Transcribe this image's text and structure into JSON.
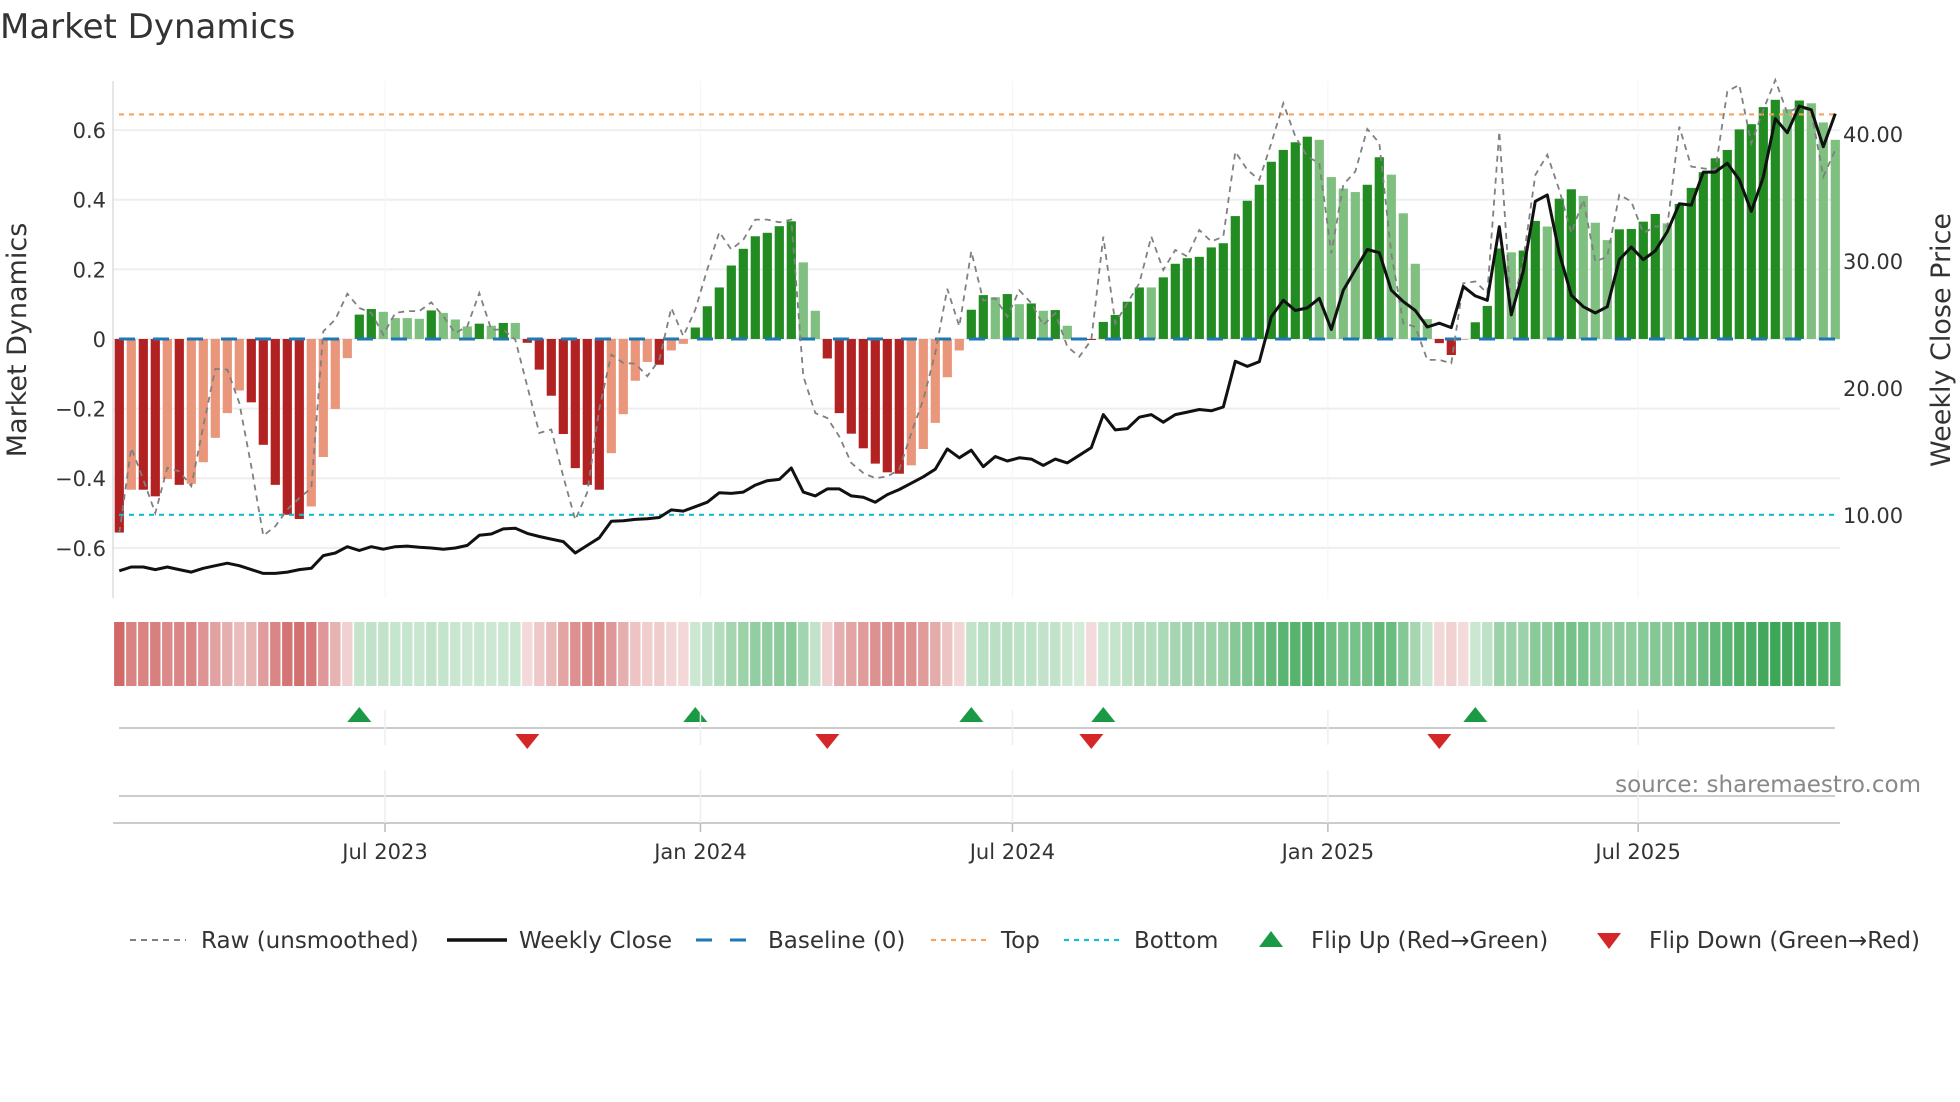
{
  "chart_data": {
    "type": "bar",
    "title": "Market Dynamics",
    "ylabel": "Market Dynamics",
    "ylabel_right": "Weekly Close Price",
    "ylim": [
      -0.744,
      0.741
    ],
    "ylim_right": [
      3.46,
      44.17
    ],
    "yticks": [
      {
        "v": 0.6,
        "label": "0.6"
      },
      {
        "v": 0.4,
        "label": "0.4"
      },
      {
        "v": 0.2,
        "label": "0.2"
      },
      {
        "v": 0,
        "label": "0"
      },
      {
        "v": -0.2,
        "label": "−0.2"
      },
      {
        "v": -0.4,
        "label": "−0.4"
      },
      {
        "v": -0.6,
        "label": "−0.6"
      }
    ],
    "yticks_right": [
      {
        "v": 40,
        "label": "40.00"
      },
      {
        "v": 30,
        "label": "30.00"
      },
      {
        "v": 20,
        "label": "20.00"
      },
      {
        "v": 10,
        "label": "10.00"
      }
    ],
    "x_start": "2023-01-27",
    "x_step_days": 7,
    "xticks": [
      {
        "date": "2023-07-01",
        "label": "Jul 2023"
      },
      {
        "date": "2024-01-01",
        "label": "Jan 2024"
      },
      {
        "date": "2024-07-01",
        "label": "Jul 2024"
      },
      {
        "date": "2025-01-01",
        "label": "Jan 2025"
      },
      {
        "date": "2025-07-01",
        "label": "Jul 2025"
      }
    ],
    "top_level": 0.645,
    "bottom_level": -0.505,
    "baseline": 0,
    "smoothed": [
      -0.556,
      -0.433,
      -0.433,
      -0.452,
      -0.402,
      -0.419,
      -0.416,
      -0.354,
      -0.284,
      -0.213,
      -0.148,
      -0.182,
      -0.304,
      -0.419,
      -0.505,
      -0.517,
      -0.481,
      -0.339,
      -0.201,
      -0.055,
      0.07,
      0.086,
      0.078,
      0.06,
      0.06,
      0.058,
      0.082,
      0.075,
      0.056,
      0.036,
      0.044,
      0.038,
      0.046,
      0.046,
      -0.011,
      -0.088,
      -0.163,
      -0.273,
      -0.371,
      -0.419,
      -0.433,
      -0.328,
      -0.216,
      -0.12,
      -0.066,
      -0.074,
      -0.033,
      -0.014,
      0.033,
      0.094,
      0.148,
      0.211,
      0.259,
      0.295,
      0.305,
      0.324,
      0.338,
      0.22,
      0.081,
      -0.056,
      -0.213,
      -0.272,
      -0.314,
      -0.358,
      -0.383,
      -0.387,
      -0.363,
      -0.316,
      -0.241,
      -0.11,
      -0.033,
      0.084,
      0.126,
      0.12,
      0.129,
      0.1,
      0.102,
      0.081,
      0.083,
      0.038,
      0.002,
      -0.003,
      0.049,
      0.069,
      0.107,
      0.148,
      0.148,
      0.177,
      0.216,
      0.232,
      0.236,
      0.263,
      0.275,
      0.353,
      0.397,
      0.443,
      0.509,
      0.543,
      0.565,
      0.581,
      0.572,
      0.465,
      0.432,
      0.422,
      0.443,
      0.522,
      0.472,
      0.361,
      0.216,
      0.057,
      -0.012,
      -0.046,
      -0.002,
      0.048,
      0.095,
      0.26,
      0.249,
      0.254,
      0.339,
      0.323,
      0.403,
      0.43,
      0.411,
      0.334,
      0.284,
      0.315,
      0.316,
      0.337,
      0.359,
      0.332,
      0.388,
      0.434,
      0.479,
      0.519,
      0.543,
      0.602,
      0.617,
      0.666,
      0.687,
      0.66,
      0.685,
      0.677,
      0.622,
      0.572
    ],
    "strength": "DLDDLDLLLLLDDDDDLLLLDDLLLLDLLLDLDLDDDDDDDLLLLDLLDDDDDDDDDLLDDDDDDDLLLLLDDLDLDLDLLDDDDDLDDDDDDDDDDDDDLLLLDDLLLLDDLDDDLDDLDDLLLDDDDLDDDDDDDDDLDLLL",
    "raw": [
      -0.557,
      -0.313,
      -0.404,
      -0.5,
      -0.37,
      -0.38,
      -0.423,
      -0.25,
      -0.086,
      -0.088,
      -0.184,
      -0.366,
      -0.565,
      -0.538,
      -0.49,
      -0.457,
      -0.428,
      0.022,
      0.056,
      0.13,
      0.089,
      0.075,
      0.012,
      0.075,
      0.08,
      0.08,
      0.105,
      0.065,
      0.017,
      0.036,
      0.132,
      0.027,
      0.027,
      -0.002,
      -0.136,
      -0.27,
      -0.26,
      -0.395,
      -0.52,
      -0.44,
      -0.2,
      -0.045,
      -0.069,
      -0.071,
      -0.107,
      -0.06,
      0.089,
      0.008,
      0.084,
      0.2,
      0.307,
      0.257,
      0.285,
      0.343,
      0.343,
      0.335,
      0.343,
      -0.107,
      -0.213,
      -0.227,
      -0.28,
      -0.356,
      -0.385,
      -0.4,
      -0.395,
      -0.375,
      -0.27,
      -0.174,
      -0.04,
      0.144,
      0.036,
      0.252,
      0.11,
      0.117,
      0.064,
      0.14,
      0.103,
      0.04,
      0.074,
      -0.022,
      -0.051,
      -0.003,
      0.294,
      0.045,
      0.103,
      0.16,
      0.294,
      0.198,
      0.256,
      0.237,
      0.313,
      0.28,
      0.294,
      0.538,
      0.486,
      0.457,
      0.562,
      0.677,
      0.582,
      0.524,
      0.505,
      0.246,
      0.443,
      0.481,
      0.603,
      0.563,
      0.246,
      0.045,
      0.035,
      -0.06,
      -0.06,
      -0.07,
      0.16,
      0.165,
      0.131,
      0.596,
      0.074,
      0.227,
      0.471,
      0.529,
      0.428,
      0.304,
      0.4,
      0.222,
      0.237,
      0.414,
      0.395,
      0.304,
      0.323,
      0.323,
      0.61,
      0.495,
      0.49,
      0.486,
      0.711,
      0.73,
      0.562,
      0.658,
      0.744,
      0.649,
      0.668,
      0.653,
      0.466,
      0.543
    ],
    "close": [
      5.6,
      5.9,
      5.9,
      5.7,
      5.9,
      5.7,
      5.5,
      5.8,
      6.0,
      6.2,
      6.0,
      5.7,
      5.4,
      5.4,
      5.5,
      5.7,
      5.8,
      6.8,
      7.0,
      7.5,
      7.2,
      7.5,
      7.3,
      7.5,
      7.55,
      7.45,
      7.4,
      7.3,
      7.4,
      7.6,
      8.4,
      8.5,
      8.9,
      8.95,
      8.55,
      8.3,
      8.1,
      7.9,
      7.0,
      7.6,
      8.2,
      9.5,
      9.55,
      9.65,
      9.7,
      9.8,
      10.4,
      10.3,
      10.65,
      11.0,
      11.75,
      11.7,
      11.8,
      12.35,
      12.7,
      12.8,
      13.7,
      11.8,
      11.5,
      12.05,
      12.05,
      11.5,
      11.4,
      11.0,
      11.6,
      12.0,
      12.5,
      13.0,
      13.6,
      15.2,
      14.5,
      15.1,
      13.8,
      14.6,
      14.25,
      14.5,
      14.4,
      13.9,
      14.4,
      14.1,
      14.7,
      15.3,
      17.9,
      16.7,
      16.8,
      17.7,
      17.9,
      17.3,
      17.9,
      18.1,
      18.3,
      18.2,
      18.5,
      22.1,
      21.7,
      22.07,
      25.6,
      26.9,
      26.1,
      26.3,
      27.06,
      24.6,
      27.7,
      29.3,
      30.9,
      30.65,
      27.7,
      26.8,
      26.1,
      24.8,
      25.1,
      24.75,
      28.0,
      27.25,
      26.9,
      32.7,
      25.75,
      29.2,
      34.7,
      35.2,
      30.6,
      27.3,
      26.4,
      25.9,
      26.4,
      30.1,
      31.1,
      30.1,
      30.8,
      32.3,
      34.5,
      34.4,
      37.0,
      37.0,
      37.7,
      36.4,
      33.9,
      36.6,
      41.2,
      40.1,
      42.2,
      41.9,
      39.0,
      41.6
    ],
    "flip_up_weeks": [
      21,
      49,
      72,
      83,
      114
    ],
    "flip_down_weeks": [
      35,
      60,
      82,
      111
    ],
    "colors": {
      "pos_strong": "#228b22",
      "pos_weak": "#7fbf7f",
      "neg_strong": "#b22222",
      "neg_weak": "#e9967a",
      "raw": "#808080",
      "close": "#111111",
      "baseline": "#1f77b4",
      "top": "#f4a460",
      "bottom": "#17becf",
      "flip_up": "#1a9a45",
      "flip_down": "#d62728"
    },
    "legend": {
      "position": "bottom",
      "items": [
        {
          "label": "Raw (unsmoothed)",
          "kind": "raw"
        },
        {
          "label": "Weekly Close",
          "kind": "close"
        },
        {
          "label": "Baseline (0)",
          "kind": "baseline"
        },
        {
          "label": "Top",
          "kind": "top"
        },
        {
          "label": "Bottom",
          "kind": "bottom"
        },
        {
          "label": "Flip Up (Red→Green)",
          "kind": "flip_up"
        },
        {
          "label": "Flip Down (Green→Red)",
          "kind": "flip_down"
        }
      ]
    },
    "source": "source: sharemaestro.com"
  }
}
